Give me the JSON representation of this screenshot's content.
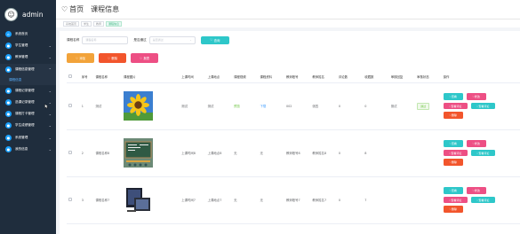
{
  "brand": {
    "name": "admin"
  },
  "sidebar": {
    "items": [
      {
        "label": "系统首页",
        "icon": "home-icon",
        "expandable": false
      },
      {
        "label": "学生管理",
        "icon": "user-icon",
        "expandable": true
      },
      {
        "label": "教师管理",
        "icon": "teacher-icon",
        "expandable": true
      },
      {
        "label": "课程信息管理",
        "icon": "book-icon",
        "expandable": true,
        "expanded": true
      },
      {
        "label": "课程信息",
        "sub": true
      },
      {
        "label": "课程记录管理",
        "icon": "record-icon",
        "expandable": true
      },
      {
        "label": "选课记录管理",
        "icon": "select-icon",
        "expandable": true
      },
      {
        "label": "课程打卡管理",
        "icon": "checkin-icon",
        "expandable": true
      },
      {
        "label": "学生成绩管理",
        "icon": "grade-icon",
        "expandable": true
      },
      {
        "label": "系统管理",
        "icon": "settings-icon",
        "expandable": true
      },
      {
        "label": "我的信息",
        "icon": "profile-icon",
        "expandable": true
      }
    ]
  },
  "header": {
    "home_label": "首页",
    "page_title": "课程信息"
  },
  "breadcrumbs": [
    "系统首页",
    "学生",
    "教师",
    "课程信息"
  ],
  "search": {
    "course_label": "课程名称",
    "course_placeholder": "课程名称",
    "passed_label": "是否通过",
    "passed_placeholder": "是否通过",
    "search_button": "查询"
  },
  "actions": {
    "add": "添加",
    "delete": "删除",
    "report": "报表"
  },
  "table": {
    "headers": [
      "",
      "序号",
      "课程名称",
      "课程图片",
      "上课时间",
      "上课地点",
      "课程视频",
      "课程资料",
      "教师账号",
      "教师姓名",
      "评论数",
      "收藏数",
      "审核回复",
      "审核状态",
      "操作"
    ],
    "rows": [
      {
        "index": "1",
        "name": "测试",
        "image": "sunflower",
        "time": "测试",
        "place": "测试",
        "video": "预览",
        "material": "下载",
        "teacher_account": "002",
        "teacher_name": "张四",
        "comments": "0",
        "favorites": "0",
        "review_reply": "测试",
        "status": "通过"
      },
      {
        "index": "2",
        "name": "课程名称8",
        "image": "chalkboard",
        "time": "上课时间8",
        "place": "上课地点8",
        "video": "无",
        "material": "无",
        "teacher_account": "教师账号8",
        "teacher_name": "教师姓名8",
        "comments": "0",
        "favorites": "8",
        "review_reply": "",
        "status": ""
      },
      {
        "index": "3",
        "name": "课程名称7",
        "image": "monitor",
        "time": "上课时间7",
        "place": "上课地点7",
        "video": "无",
        "material": "无",
        "teacher_account": "教师账号7",
        "teacher_name": "教师姓名7",
        "comments": "0",
        "favorites": "7",
        "review_reply": "",
        "status": ""
      }
    ],
    "op_labels": {
      "view": "查看",
      "edit": "修改",
      "comment": "查看评论",
      "review_comment": "查看评论",
      "delete": "删除"
    }
  },
  "colors": {
    "sidebar": "#1f2d3d",
    "accent": "#2ec7c9",
    "orange": "#f2a33a",
    "red": "#f2552c",
    "pink": "#ed4f84",
    "nav_icon": "#19a0ff"
  }
}
